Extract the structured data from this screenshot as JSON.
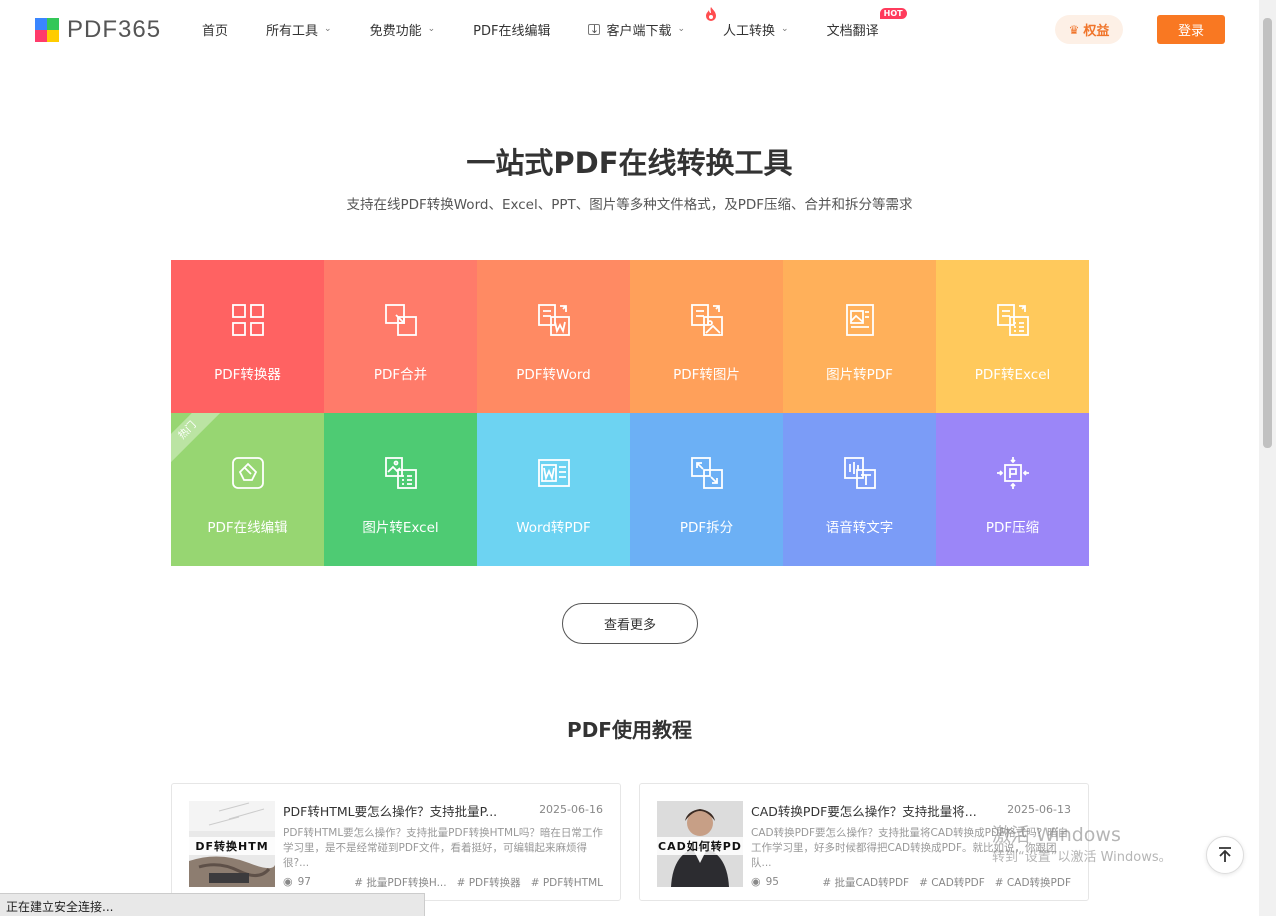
{
  "header": {
    "logo_text": "PDF365",
    "nav": [
      {
        "label": "首页",
        "chevron": false
      },
      {
        "label": "所有工具",
        "chevron": true
      },
      {
        "label": "免费功能",
        "chevron": true
      },
      {
        "label": "PDF在线编辑",
        "chevron": false
      },
      {
        "label": "客户端下载",
        "chevron": true
      },
      {
        "label": "人工转换",
        "chevron": true
      },
      {
        "label": "文档翻译",
        "chevron": false
      }
    ],
    "hot_badge": "HOT",
    "quanyi_label": "权益",
    "login_label": "登录"
  },
  "hero": {
    "title": "一站式PDF在线转换工具",
    "subtitle": "支持在线PDF转换Word、Excel、PPT、图片等多种文件格式，及PDF压缩、合并和拆分等需求"
  },
  "tools": [
    {
      "label": "PDF转换器",
      "color": "#ff6262",
      "icon": "grid-icon"
    },
    {
      "label": "PDF合并",
      "color": "#ff7b6a",
      "icon": "merge-icon"
    },
    {
      "label": "PDF转Word",
      "color": "#ff8a63",
      "icon": "pdf-to-word-icon"
    },
    {
      "label": "PDF转图片",
      "color": "#ffa05a",
      "icon": "pdf-to-image-icon"
    },
    {
      "label": "图片转PDF",
      "color": "#ffb05a",
      "icon": "image-to-pdf-icon"
    },
    {
      "label": "PDF转Excel",
      "color": "#ffc95c",
      "icon": "pdf-to-excel-icon"
    },
    {
      "label": "PDF在线编辑",
      "color": "#97d672",
      "icon": "edit-icon",
      "ribbon": "热门"
    },
    {
      "label": "图片转Excel",
      "color": "#4ecb73",
      "icon": "image-to-excel-icon"
    },
    {
      "label": "Word转PDF",
      "color": "#6dd3f2",
      "icon": "word-to-pdf-icon"
    },
    {
      "label": "PDF拆分",
      "color": "#6cb0f5",
      "icon": "split-icon"
    },
    {
      "label": "语音转文字",
      "color": "#7b9cf7",
      "icon": "speech-to-text-icon"
    },
    {
      "label": "PDF压缩",
      "color": "#9b86f8",
      "icon": "compress-icon"
    }
  ],
  "more_button": "查看更多",
  "tutorials_title": "PDF使用教程",
  "articles": [
    {
      "thumb_text": "DF转换HTM",
      "title": "PDF转HTML要怎么操作？支持批量P...",
      "date": "2025-06-16",
      "desc": "PDF转HTML要怎么操作？支持批量PDF转换HTML吗？暗在日常工作学习里，是不是经常碰到PDF文件，看着挺好，可编辑起来麻烦得很?...",
      "views": "97",
      "tags": [
        "# 批量PDF转换H...",
        "# PDF转换器",
        "# PDF转HTML"
      ]
    },
    {
      "thumb_text": "CAD如何转PD",
      "title": "CAD转换PDF要怎么操作？支持批量将...",
      "date": "2025-06-13",
      "desc": "CAD转换PDF要怎么操作？支持批量将CAD转换成PDF格式吗？暗自工作学习里，好多时候都得把CAD转换成PDF。就比如说，你跟团队...",
      "views": "95",
      "tags": [
        "# 批量CAD转PDF",
        "# CAD转PDF",
        "# CAD转换PDF"
      ]
    }
  ],
  "watermark": {
    "line1": "激活 Windows",
    "line2": "转到“设置”以激活 Windows。"
  },
  "status_text": "正在建立安全连接..."
}
